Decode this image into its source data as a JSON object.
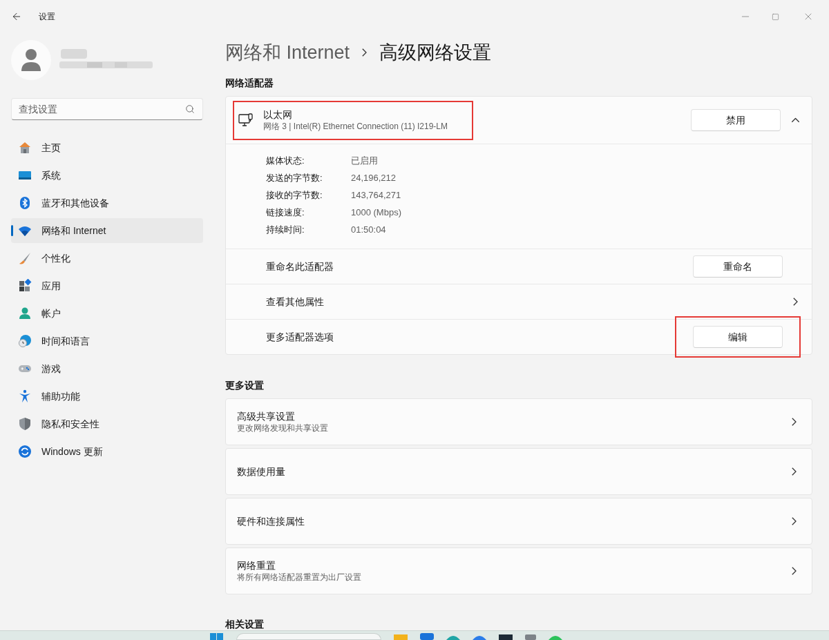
{
  "window": {
    "title": "设置"
  },
  "search": {
    "placeholder": "查找设置"
  },
  "sidebar": {
    "items": [
      {
        "label": "主页",
        "selected": false
      },
      {
        "label": "系统",
        "selected": false
      },
      {
        "label": "蓝牙和其他设备",
        "selected": false
      },
      {
        "label": "网络和 Internet",
        "selected": true
      },
      {
        "label": "个性化",
        "selected": false
      },
      {
        "label": "应用",
        "selected": false
      },
      {
        "label": "帐户",
        "selected": false
      },
      {
        "label": "时间和语言",
        "selected": false
      },
      {
        "label": "游戏",
        "selected": false
      },
      {
        "label": "辅助功能",
        "selected": false
      },
      {
        "label": "隐私和安全性",
        "selected": false
      },
      {
        "label": "Windows 更新",
        "selected": false
      }
    ]
  },
  "breadcrumb": {
    "parent": "网络和 Internet",
    "current": "高级网络设置"
  },
  "adapter_section": {
    "heading": "网络适配器",
    "adapter": {
      "name": "以太网",
      "description": "网络 3 | Intel(R) Ethernet Connection (11) I219-LM",
      "highlighted": true,
      "expanded": true,
      "button": "禁用"
    },
    "details": [
      {
        "label": "媒体状态:",
        "value": "已启用"
      },
      {
        "label": "发送的字节数:",
        "value": "24,196,212"
      },
      {
        "label": "接收的字节数:",
        "value": "143,764,271"
      },
      {
        "label": "链接速度:",
        "value": "1000 (Mbps)"
      },
      {
        "label": "持续时间:",
        "value": "01:50:04"
      }
    ],
    "rows": [
      {
        "kind": "button",
        "label": "重命名此适配器",
        "button": "重命名",
        "highlighted": false
      },
      {
        "kind": "link",
        "label": "查看其他属性"
      },
      {
        "kind": "button",
        "label": "更多适配器选项",
        "button": "编辑",
        "highlighted": true
      }
    ]
  },
  "more_settings": {
    "heading": "更多设置",
    "items": [
      {
        "title": "高级共享设置",
        "subtitle": "更改网络发现和共享设置"
      },
      {
        "title": "数据使用量"
      },
      {
        "title": "硬件和连接属性"
      },
      {
        "title": "网络重置",
        "subtitle": "将所有网络适配器重置为出厂设置"
      }
    ]
  },
  "related_settings": {
    "heading": "相关设置"
  }
}
